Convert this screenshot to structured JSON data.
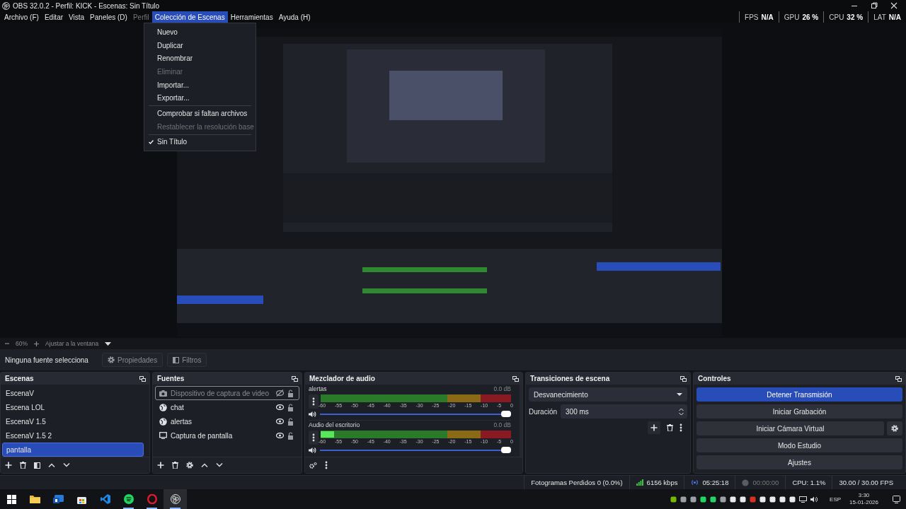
{
  "window": {
    "title": "OBS 32.0.2 - Perfil: KICK - Escenas: Sin Título"
  },
  "menu": [
    {
      "label": "Archivo (F)",
      "selected": false,
      "disabled": false
    },
    {
      "label": "Editar",
      "selected": false,
      "disabled": false
    },
    {
      "label": "Vista",
      "selected": false,
      "disabled": false
    },
    {
      "label": "Paneles (D)",
      "selected": false,
      "disabled": false
    },
    {
      "label": "Perfil",
      "selected": false,
      "disabled": true
    },
    {
      "label": "Colección de Escenas",
      "selected": true,
      "disabled": false
    },
    {
      "label": "Herramientas",
      "selected": false,
      "disabled": false
    },
    {
      "label": "Ayuda (H)",
      "selected": false,
      "disabled": false
    }
  ],
  "stats": [
    {
      "label": "FPS",
      "value": "N/A"
    },
    {
      "label": "GPU",
      "value": "26 %"
    },
    {
      "label": "CPU",
      "value": "32 %"
    },
    {
      "label": "LAT",
      "value": "N/A"
    }
  ],
  "dropdown": {
    "items": [
      {
        "kind": "item",
        "label": "Nuevo",
        "disabled": false,
        "checked": false
      },
      {
        "kind": "item",
        "label": "Duplicar",
        "disabled": false,
        "checked": false
      },
      {
        "kind": "item",
        "label": "Renombrar",
        "disabled": false,
        "checked": false
      },
      {
        "kind": "item",
        "label": "Eliminar",
        "disabled": true,
        "checked": false
      },
      {
        "kind": "item",
        "label": "Importar...",
        "disabled": false,
        "checked": false
      },
      {
        "kind": "item",
        "label": "Exportar...",
        "disabled": false,
        "checked": false
      },
      {
        "kind": "separator"
      },
      {
        "kind": "item",
        "label": "Comprobar si faltan archivos",
        "disabled": false,
        "checked": false
      },
      {
        "kind": "item",
        "label": "Restablecer la resolución base",
        "disabled": true,
        "checked": false
      },
      {
        "kind": "separator"
      },
      {
        "kind": "item",
        "label": "Sin Título",
        "disabled": false,
        "checked": true
      }
    ]
  },
  "zoom_bar": {
    "zoom": "60%",
    "fit": "Ajustar a la ventana"
  },
  "context_bar": {
    "label": "Ninguna fuente selecciona",
    "buttons": [
      {
        "label": "Propiedades",
        "kind": "gear",
        "disabled": true
      },
      {
        "label": "Filtros",
        "kind": "filter",
        "disabled": true
      }
    ]
  },
  "scenes": {
    "title": "Escenas",
    "items": [
      {
        "label": "EscenaV",
        "selected": false
      },
      {
        "label": "Escena LOL",
        "selected": false
      },
      {
        "label": "EscenaV 1.5",
        "selected": false
      },
      {
        "label": "EscenaV 1.5 2",
        "selected": false
      },
      {
        "label": "pantalla",
        "selected": true
      }
    ]
  },
  "sources": {
    "title": "Fuentes",
    "items": [
      {
        "label": "Dispositivo de captura de video",
        "kind": "camera",
        "visible": false,
        "focused": true
      },
      {
        "label": "chat",
        "kind": "browser",
        "visible": true,
        "focused": false
      },
      {
        "label": "alertas",
        "kind": "browser",
        "visible": true,
        "focused": false
      },
      {
        "label": "Captura de pantalla",
        "kind": "display",
        "visible": true,
        "focused": false
      }
    ]
  },
  "mixer": {
    "title": "Mezclador de audio",
    "channels": [
      {
        "name": "alertas",
        "reading": "0.0 dB",
        "meter": {
          "level": 0
        },
        "fader": {
          "level": 1
        },
        "ticks": [
          "-60",
          "-55",
          "-50",
          "-45",
          "-40",
          "-35",
          "-30",
          "-25",
          "-20",
          "-15",
          "-10",
          "-5",
          "0"
        ]
      },
      {
        "name": "Audio del escritorio",
        "reading": "0.0 dB",
        "meter": {
          "level": 0.07
        },
        "fader": {
          "level": 1
        },
        "ticks": [
          "-60",
          "-55",
          "-50",
          "-45",
          "-40",
          "-35",
          "-30",
          "-25",
          "-20",
          "-15",
          "-10",
          "-5",
          "0"
        ]
      }
    ]
  },
  "transitions": {
    "title": "Transiciones de escena",
    "selected": "Desvanecimiento",
    "duration_label": "Duración",
    "duration": "300 ms"
  },
  "controls": {
    "title": "Controles",
    "buttons": [
      {
        "label": "Detener Transmisión",
        "active": true,
        "kind": "plain"
      },
      {
        "label": "Iniciar Grabación",
        "active": false,
        "kind": "plain"
      },
      {
        "label": "Iniciar Cámara Virtual",
        "active": false,
        "kind": "with-settings"
      },
      {
        "label": "Modo Estudio",
        "active": false,
        "kind": "plain"
      },
      {
        "label": "Ajustes",
        "active": false,
        "kind": "plain"
      }
    ]
  },
  "status_bar": {
    "dropped": "Fotogramas Perdidos 0 (0.0%)",
    "bitrate": "6156 kbps",
    "streaming": true,
    "stream_time": "05:25:18",
    "recording": false,
    "rec_time": "00:00:00",
    "cpu": "CPU: 1.1%",
    "fps": "30.00 / 30.00 FPS"
  },
  "taskbar": {
    "apps": [
      {
        "kind": "start",
        "running": false,
        "active": false
      },
      {
        "kind": "folder",
        "running": false,
        "active": false
      },
      {
        "kind": "mail",
        "running": false,
        "active": false
      },
      {
        "kind": "store",
        "running": false,
        "active": false
      },
      {
        "kind": "code",
        "running": false,
        "active": false
      },
      {
        "kind": "music",
        "running": true,
        "active": false
      },
      {
        "kind": "browser",
        "running": true,
        "active": false
      },
      {
        "kind": "obs",
        "running": true,
        "active": true
      }
    ],
    "language": "ESP",
    "time": "3:30",
    "date": "15-01-2026"
  }
}
